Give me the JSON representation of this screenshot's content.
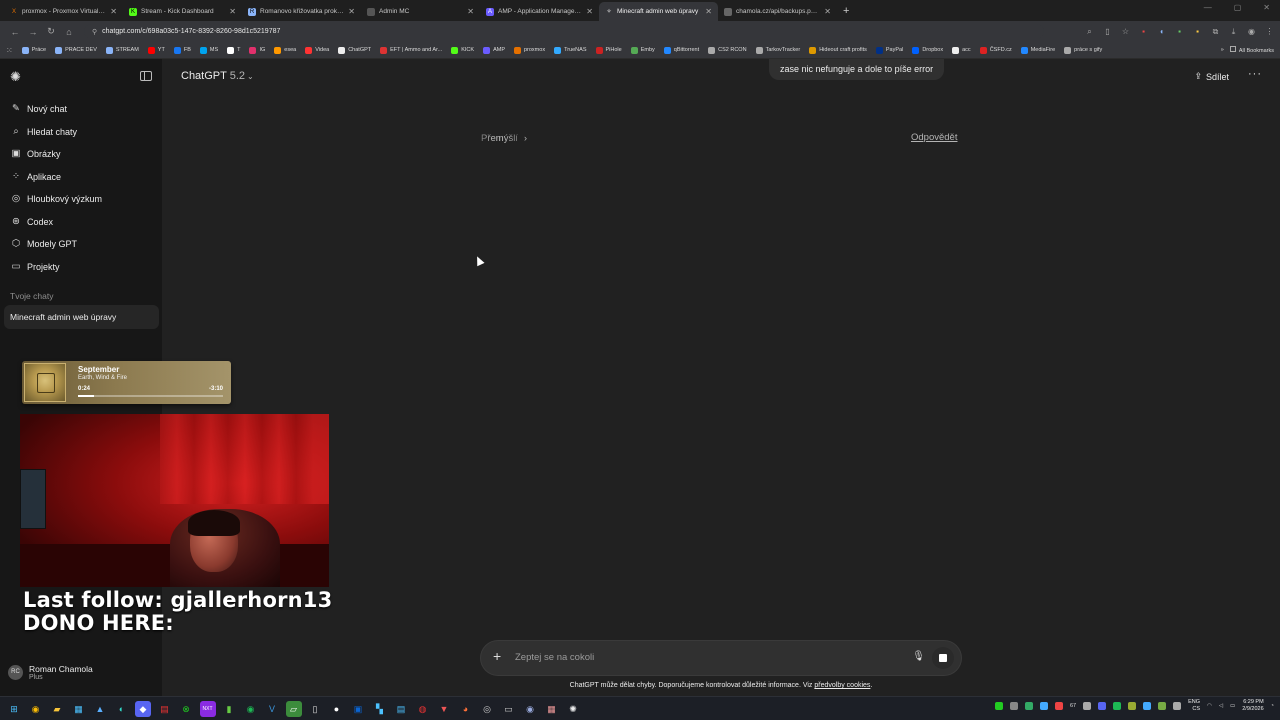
{
  "browser": {
    "tabs": [
      {
        "title": "proxmox - Proxmox Virtual Environment",
        "color": "#e57000",
        "glyph": "X"
      },
      {
        "title": "Stream - Kick Dashboard",
        "color": "#53fc18",
        "glyph": "K"
      },
      {
        "title": "Romanovo křižovatka prokliků",
        "color": "#8ab4f8",
        "glyph": "R"
      },
      {
        "title": "Admin MC",
        "color": "#888888",
        "glyph": ""
      },
      {
        "title": "AMP - Application Management Panel",
        "color": "#6b5cff",
        "glyph": "A"
      },
      {
        "title": "Minecraft admin web úpravy",
        "color": "#ffffff",
        "glyph": "✧"
      },
      {
        "title": "chamola.cz/api/backups.php?a",
        "color": "#777777",
        "glyph": ""
      }
    ],
    "active_tab": 5,
    "new_tab": "+",
    "url": "chatgpt.com/c/698a03c5-147c-8392-8260-98d1c5219787",
    "bookmarks": [
      "Práce",
      "PRACE DEV",
      "STREAM",
      "YT",
      "FB",
      "MS",
      "T",
      "IG",
      "esea",
      "Videa",
      "ChatGPT",
      "EFT | Ammo and Ar...",
      "KICK",
      "AMP",
      "proxmox",
      "TrueNAS",
      "PiHole",
      "Emby",
      "qBittorrent",
      "CS2 RCON",
      "TarkovTracker",
      "Hideout craft profits",
      "PayPal",
      "Dropbox",
      "acc",
      "ČSFD.cz",
      "MediaFire",
      "práce s gify"
    ],
    "all_bookmarks": "All Bookmarks"
  },
  "sidebar": {
    "items": [
      {
        "label": "Nový chat",
        "icon": "✎"
      },
      {
        "label": "Hledat chaty",
        "icon": "⌕"
      },
      {
        "label": "Obrázky",
        "icon": "▣"
      },
      {
        "label": "Aplikace",
        "icon": "⁘"
      },
      {
        "label": "Hloubkový výzkum",
        "icon": "◎"
      },
      {
        "label": "Codex",
        "icon": "⊛"
      },
      {
        "label": "Modely GPT",
        "icon": "⬡"
      },
      {
        "label": "Projekty",
        "icon": "▭"
      }
    ],
    "section_title": "Tvoje chaty",
    "chats": [
      "Minecraft admin web úpravy"
    ],
    "user": {
      "name": "Roman Chamola",
      "plan": "Plus",
      "initials": "RC"
    }
  },
  "music": {
    "song": "September",
    "artist": "Earth, Wind & Fire",
    "current": "0:24",
    "remaining": "-3:10",
    "progress": 0.11
  },
  "stream_overlay": {
    "last_follow": "Last follow: gjallerhorn13",
    "donate": "DONO HERE:"
  },
  "header": {
    "model": "ChatGPT",
    "version": "5.2",
    "share": "Sdílet"
  },
  "chat": {
    "user_message": "zase nic nefunguje a dole to píše error",
    "thinking": "Přemýšlí",
    "answer_now": "Odpovědět"
  },
  "composer": {
    "placeholder": "Zeptej se na cokoli"
  },
  "disclaimer": {
    "text": "ChatGPT může dělat chyby. Doporučujeme kontrolovat důležité informace. Viz ",
    "link": "předvolby cookies",
    "end": "."
  },
  "taskbar": {
    "lang": "ENG",
    "lang2": "CS",
    "time": "6:29 PM",
    "date": "2/9/2026",
    "badge": "67"
  }
}
